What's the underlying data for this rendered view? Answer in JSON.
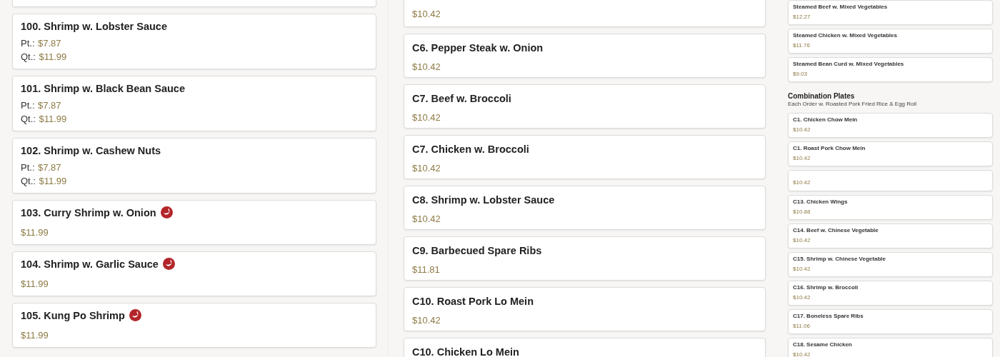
{
  "left_column": {
    "top_cut_card": true,
    "items": [
      {
        "name": "100. Shrimp w. Lobster Sauce",
        "spicy": false,
        "prices": [
          {
            "label": "Pt.:",
            "price": "$7.87"
          },
          {
            "label": "Qt.:",
            "price": "$11.99"
          }
        ]
      },
      {
        "name": "101. Shrimp w. Black Bean Sauce",
        "spicy": false,
        "prices": [
          {
            "label": "Pt.:",
            "price": "$7.87"
          },
          {
            "label": "Qt.:",
            "price": "$11.99"
          }
        ]
      },
      {
        "name": "102. Shrimp w. Cashew Nuts",
        "spicy": false,
        "prices": [
          {
            "label": "Pt.:",
            "price": "$7.87"
          },
          {
            "label": "Qt.:",
            "price": "$11.99"
          }
        ]
      },
      {
        "name": "103. Curry Shrimp w. Onion",
        "spicy": true,
        "prices": [
          {
            "price": "$11.99"
          }
        ]
      },
      {
        "name": "104. Shrimp w. Garlic Sauce",
        "spicy": true,
        "prices": [
          {
            "price": "$11.99"
          }
        ]
      },
      {
        "name": "105. Kung Po Shrimp",
        "spicy": true,
        "prices": [
          {
            "price": "$11.99"
          }
        ]
      }
    ]
  },
  "middle_column": {
    "items": [
      {
        "price": "$10.42"
      },
      {
        "name": "C6. Pepper Steak w. Onion",
        "price": "$10.42"
      },
      {
        "name": "C7. Beef w. Broccoli",
        "price": "$10.42"
      },
      {
        "name": "C7. Chicken w. Broccoli",
        "price": "$10.42"
      },
      {
        "name": "C8. Shrimp w. Lobster Sauce",
        "price": "$10.42"
      },
      {
        "name": "C9. Barbecued Spare Ribs",
        "price": "$11.81"
      },
      {
        "name": "C10. Roast Pork Lo Mein",
        "price": "$10.42"
      },
      {
        "name": "C10. Chicken Lo Mein"
      }
    ]
  },
  "right_column": {
    "entries": [
      {
        "kind": "dish",
        "name": "Steamed Beef w. Mixed Vegetables",
        "price": "$12.27"
      },
      {
        "kind": "dish",
        "name": "Steamed Chicken w. Mixed Vegetables",
        "price": "$11.76"
      },
      {
        "kind": "dish",
        "name": "Steamed Bean Curd w. Mixed Vegetables",
        "price": "$9.03"
      },
      {
        "kind": "heading",
        "title": "Combination Plates",
        "subtitle": "Each Order w. Roasted Pork Fried Rice & Egg Roll"
      },
      {
        "kind": "dish",
        "name": "C1. Chicken Chow Mein",
        "price": "$10.42"
      },
      {
        "kind": "dish",
        "name": "C1. Roast Pork Chow Mein",
        "price": "$10.42"
      },
      {
        "kind": "dish",
        "price": "$10.42"
      },
      {
        "kind": "dish",
        "name": "C13. Chicken Wings",
        "price": "$10.88"
      },
      {
        "kind": "dish",
        "name": "C14. Beef w. Chinese Vegetable",
        "price": "$10.42"
      },
      {
        "kind": "dish",
        "name": "C15. Shrimp w. Chinese Vegetable",
        "price": "$10.42"
      },
      {
        "kind": "dish",
        "name": "C16. Shrimp w. Broccoli",
        "price": "$10.42"
      },
      {
        "kind": "dish",
        "name": "C17. Boneless Spare Ribs",
        "price": "$11.06"
      },
      {
        "kind": "dish",
        "name": "C18. Sesame Chicken",
        "price": "$10.42"
      }
    ]
  }
}
